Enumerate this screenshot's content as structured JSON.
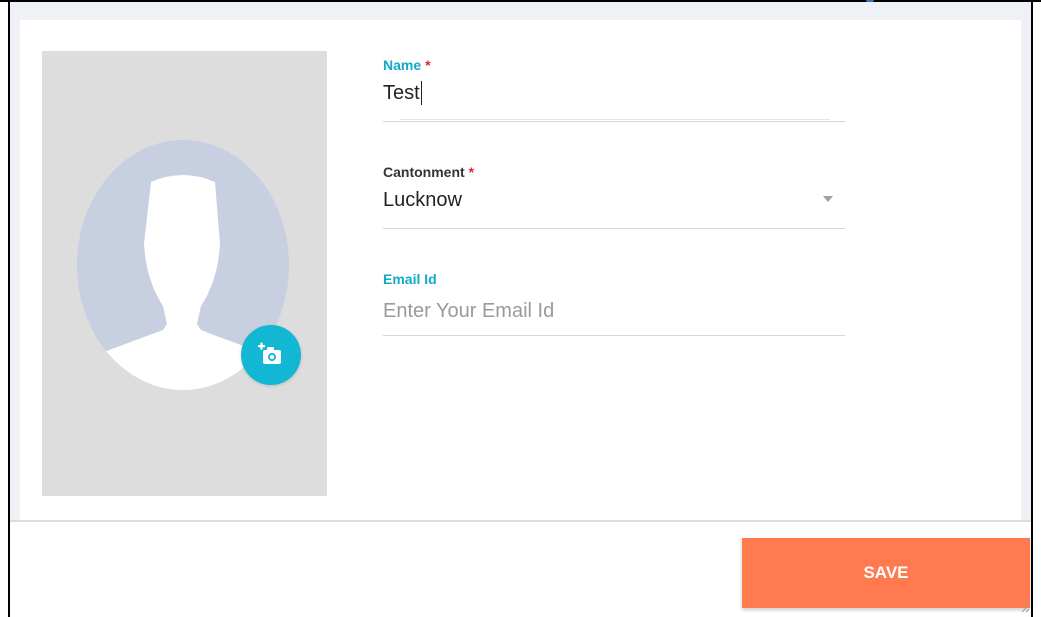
{
  "form": {
    "name": {
      "label": "Name",
      "required_mark": "*",
      "value": "Test"
    },
    "cantonment": {
      "label": "Cantonment",
      "required_mark": "*",
      "value": "Lucknow"
    },
    "email": {
      "label": "Email Id",
      "placeholder": "Enter Your Email Id",
      "value": ""
    }
  },
  "photo": {
    "avatar_icon": "person-silhouette-icon",
    "upload_icon": "add-photo-icon"
  },
  "footer": {
    "save_label": "SAVE"
  },
  "colors": {
    "accent": "#12a9c6",
    "required": "#e2243a",
    "save_button": "#ff7a4f",
    "photo_panel": "#dddddd",
    "avatar_bg": "#c7cfe0"
  }
}
